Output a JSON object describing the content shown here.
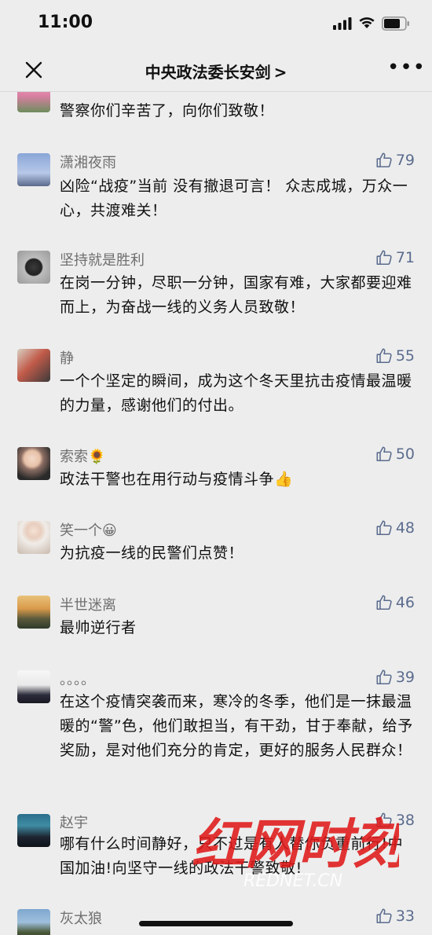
{
  "status_bar": {
    "time": "11:00"
  },
  "nav": {
    "title": "中央政法委长安剑",
    "chevron": ">"
  },
  "comments": [
    {
      "name": "",
      "text": "警察你们辛苦了，向你们致敬！",
      "likes": ""
    },
    {
      "name": "潇湘夜雨",
      "text": "凶险“战疫”当前 没有撤退可言！ 众志成城，万众一心，共渡难关！",
      "likes": "79"
    },
    {
      "name": "坚持就是胜利",
      "text": "在岗一分钟，尽职一分钟，国家有难，大家都要迎难而上，为奋战一线的义务人员致敬！",
      "likes": "71"
    },
    {
      "name": "静",
      "text": "一个个坚定的瞬间，成为这个冬天里抗击疫情最温暖的力量，感谢他们的付出。",
      "likes": "55"
    },
    {
      "name": "索索🌻",
      "text": "政法干警也在用行动与疫情斗争👍",
      "likes": "50"
    },
    {
      "name": "笑一个😀",
      "text": "为抗疫一线的民警们点赞！",
      "likes": "48"
    },
    {
      "name": "半世迷离",
      "text": "最帅逆行者",
      "likes": "46"
    },
    {
      "name": "。。。。",
      "text": "在这个疫情突袭而来，寒冷的冬季，他们是一抹最温暖的“警”色，他们敢担当，有干劲，甘于奉献，给予奖励，是对他们充分的肯定，更好的服务人民群众！",
      "likes": "39"
    },
    {
      "name": "赵宇",
      "text": "哪有什么时间静好，只不过是有人替你负重前行!中国加油!向坚守一线的政法干警致敬!",
      "likes": "38"
    },
    {
      "name": "灰太狼",
      "text": "",
      "likes": "33"
    }
  ],
  "watermark": {
    "main": "红网时刻",
    "sub": "REDNET.CN"
  },
  "colors": {
    "background": "#ededed",
    "name": "#6f6f6f",
    "like": "#5b6c8e",
    "watermark": "#e01a1a"
  }
}
